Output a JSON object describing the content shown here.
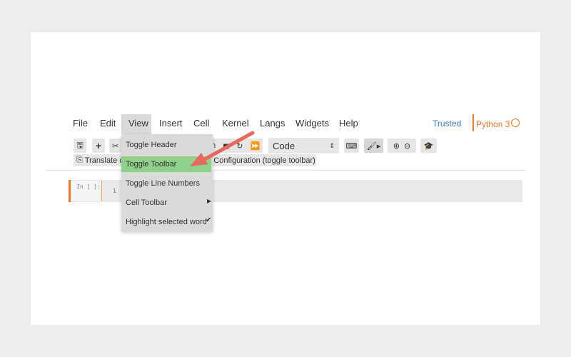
{
  "menubar": {
    "items": [
      "File",
      "Edit",
      "View",
      "Insert",
      "Cell",
      "Kernel",
      "Langs",
      "Widgets",
      "Help"
    ],
    "trusted": "Trusted",
    "kernel": "Python 3"
  },
  "toolbar": {
    "run_fragment": "n",
    "cell_type": "Code",
    "translate_fragment": "Translate c",
    "config_fragment": ": Configuration (toggle toolbar)"
  },
  "cell": {
    "prompt": "In [ ]:",
    "line_number": "1"
  },
  "view_menu": {
    "items": [
      "Toggle Header",
      "Toggle Toolbar",
      "Toggle Line Numbers",
      "Cell Toolbar",
      "Highlight selected word"
    ],
    "highlighted": "Toggle Toolbar"
  },
  "colors": {
    "accent": "#f37626",
    "trusted": "#337ab7",
    "highlight": "#8fd18a",
    "arrow": "#e8685e"
  }
}
